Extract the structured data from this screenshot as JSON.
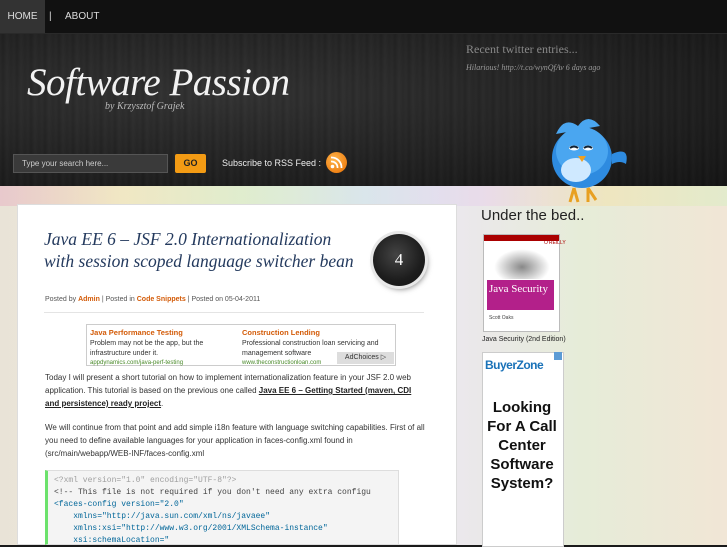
{
  "nav": {
    "items": [
      "HOME",
      "ABOUT"
    ],
    "separator": "|"
  },
  "header": {
    "site_title": "Software Passion",
    "byline": "by Krzysztof Grajek",
    "twitter_title": "Recent twitter entries...",
    "twitter_entry": "Hilarious! http://t.co/wynQfAv 6 days ago",
    "search_placeholder": "Type your search here...",
    "go_label": "GO",
    "rss_label": "Subscribe to RSS Feed :"
  },
  "post": {
    "title": "Java EE 6 – JSF 2.0 Internationalization with session scoped language switcher bean",
    "comment_count": "4",
    "meta": {
      "posted_by": "Posted by",
      "author": "Admin",
      "posted_in": "| Posted in",
      "category": "Code Snippets",
      "posted_on": "| Posted on 05-04-2011"
    },
    "ad": {
      "left": {
        "title": "Java Performance Testing",
        "text": "Problem may not be the app, but the infrastructure under it.",
        "url": "appdynamics.com/java-perf-testing"
      },
      "right": {
        "title": "Construction Lending",
        "text": "Professional construction loan servicing and management software",
        "url": "www.theconstructionloan.com"
      },
      "choices": "AdChoices ▷"
    },
    "para1_text": "Today I will present a short tutorial on how to implement internationalization feature in your JSF 2.0 web application. This tutorial is based on the previous one called ",
    "para1_link": "Java EE 6 – Getting Started (maven, CDI and persistence) ready project",
    "para1_end": ".",
    "para2": "We will continue from that point and add simple i18n feature with language switching capabilities. First of all you need to define available languages for your application in faces-config.xml found in (src/main/webapp/WEB-INF/faces-config.xml",
    "code_lines": [
      "<?xml version=\"1.0\" encoding=\"UTF-8\"?>",
      "<!-- This file is not required if you don't need any extra configu",
      "<faces-config version=\"2.0\"",
      "    xmlns=\"http://java.sun.com/xml/ns/javaee\"",
      "    xmlns:xsi=\"http://www.w3.org/2001/XMLSchema-instance\"",
      "    xsi:schemaLocation=\""
    ]
  },
  "sidebar": {
    "title": "Under the bed..",
    "book": {
      "publisher": "O'REILLY",
      "title": "Java Security",
      "author": "Scott Oaks",
      "caption": "Java Security (2nd Edition)"
    },
    "ad": {
      "brand": "BuyerZone",
      "text": "Looking For A Call Center Software System?"
    }
  },
  "colors": {
    "accent": "#f39b14",
    "link": "#d35b08",
    "title": "#243a5e"
  }
}
